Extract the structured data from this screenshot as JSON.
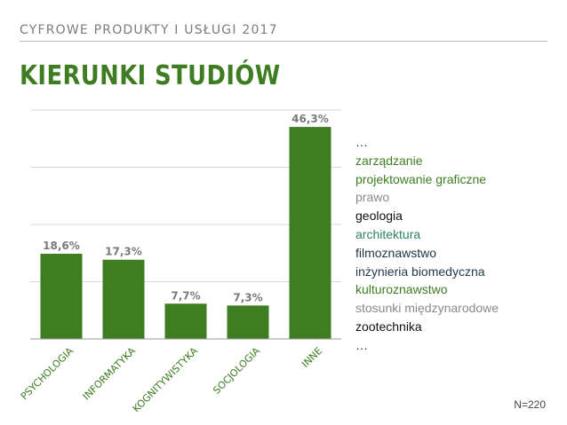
{
  "header": {
    "subtitle": "CYFROWE PRODUKTY I USŁUGI 2017",
    "title": "KIERUNKI STUDIÓW"
  },
  "chart_data": {
    "type": "bar",
    "categories": [
      "PSYCHOLOGIA",
      "INFORMATYKA",
      "KOGNITYWISTYKA",
      "SOCJOLOGIA",
      "INNE"
    ],
    "values": [
      18.6,
      17.3,
      7.7,
      7.3,
      46.3
    ],
    "value_labels": [
      "18,6%",
      "17,3%",
      "7,7%",
      "7,3%",
      "46,3%"
    ],
    "ylim": [
      0,
      50
    ],
    "grid": true,
    "bar_color": "#3e7d21"
  },
  "other_fields": {
    "items": [
      {
        "label": "…",
        "color": "#333333"
      },
      {
        "label": "zarządzanie",
        "color": "#3e7d21"
      },
      {
        "label": "projektowanie graficzne",
        "color": "#3e7d21"
      },
      {
        "label": "prawo",
        "color": "#8a8a8a"
      },
      {
        "label": "geologia",
        "color": "#111111"
      },
      {
        "label": "architektura",
        "color": "#2e7f6a"
      },
      {
        "label": "filmoznawstwo",
        "color": "#1f3442"
      },
      {
        "label": "inżynieria biomedyczna",
        "color": "#1f3a4c"
      },
      {
        "label": "kulturoznawstwo",
        "color": "#3e7d21"
      },
      {
        "label": "stosunki międzynarodowe",
        "color": "#8a8a8a"
      },
      {
        "label": "zootechnika",
        "color": "#111111"
      },
      {
        "label": "…",
        "color": "#333333"
      }
    ]
  },
  "footnote": "N=220"
}
